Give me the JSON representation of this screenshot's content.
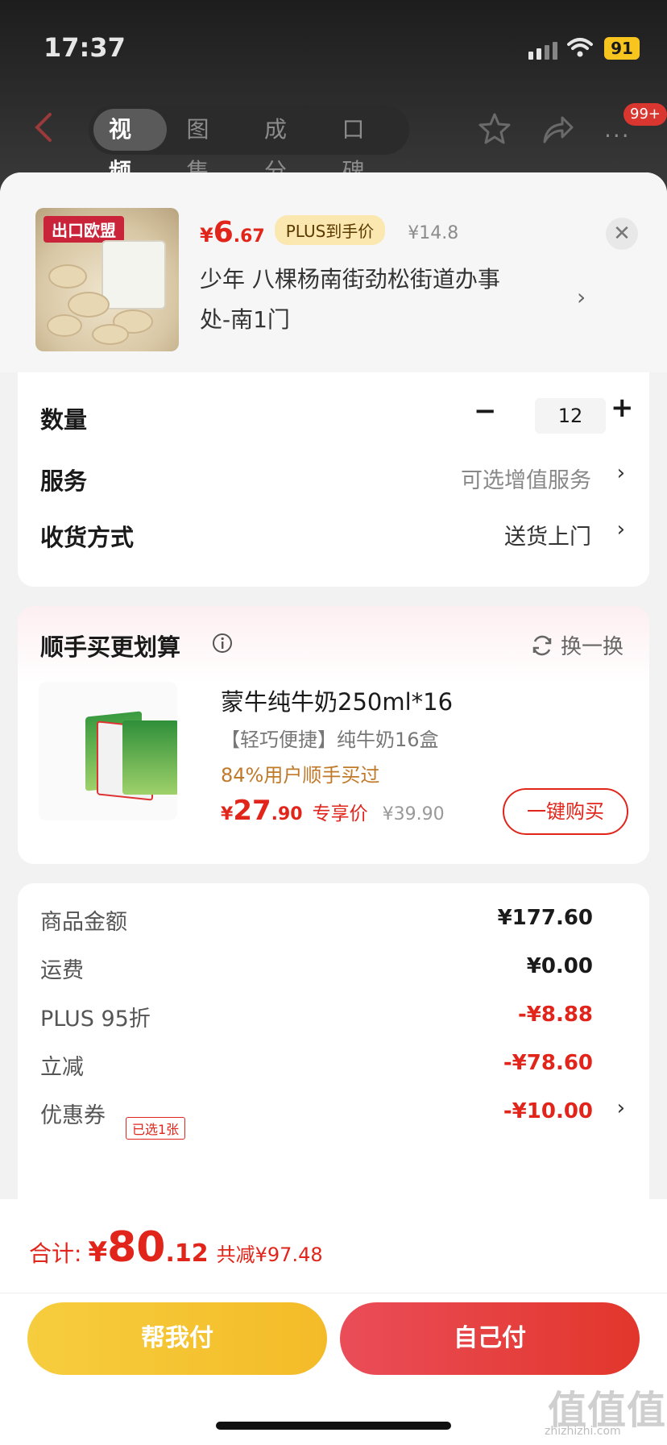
{
  "status_bar": {
    "time": "17:37",
    "battery": "91"
  },
  "nav": {
    "tabs": [
      {
        "label": "视频",
        "active": true
      },
      {
        "label": "图集",
        "active": false
      },
      {
        "label": "成分",
        "active": false
      },
      {
        "label": "口碑",
        "active": false
      }
    ],
    "more_badge": "99+"
  },
  "product": {
    "image_tag": "出口欧盟",
    "price_symbol": "¥",
    "price_int": "6",
    "price_dec": ".67",
    "plus_badge": "PLUS到手价",
    "old_price": "¥14.8",
    "address_line1": "少年  八棵杨南街劲松街道办事",
    "address_line2": "处-南1门"
  },
  "options": {
    "quantity_label": "数量",
    "quantity_value": "12",
    "service_label": "服务",
    "service_value": "可选增值服务",
    "delivery_label": "收货方式",
    "delivery_value": "送货上门"
  },
  "upsell": {
    "title": "顺手买更划算",
    "refresh_label": "换一换",
    "name": "蒙牛纯牛奶250ml*16",
    "desc": "【轻巧便捷】纯牛奶16盒",
    "stat": "84%用户顺手买过",
    "price_symbol": "¥",
    "price_int": "27",
    "price_dec": ".90",
    "price_tag": "专享价",
    "old_price": "¥39.90",
    "buy_button": "一键购买"
  },
  "summary": {
    "rows": [
      {
        "label": "商品金额",
        "value": "¥177.60"
      },
      {
        "label": "运费",
        "value": "¥0.00"
      },
      {
        "label": "PLUS 95折",
        "value": "-¥8.88"
      },
      {
        "label": "立减",
        "value": "-¥78.60"
      },
      {
        "label": "优惠券",
        "value": "-¥10.00"
      }
    ],
    "coupon_tag": "已选1张"
  },
  "bottom": {
    "total_label": "合计:",
    "total_symbol": "¥",
    "total_int": "80",
    "total_dec": ".12",
    "total_discount": "共减¥97.48",
    "pay_friend": "帮我付",
    "pay_self": "自己付"
  },
  "watermark": {
    "main": "值值值",
    "sub": "zhizhizhi.com"
  },
  "colors": {
    "accent_red": "#e1251b",
    "plus_gold": "#fbe8b0",
    "pay_yellow": "#f6cd3e"
  },
  "icons": [
    "back-icon",
    "star-icon",
    "share-icon",
    "more-icon",
    "close-icon",
    "info-icon",
    "refresh-icon",
    "chevron-right-icon"
  ]
}
